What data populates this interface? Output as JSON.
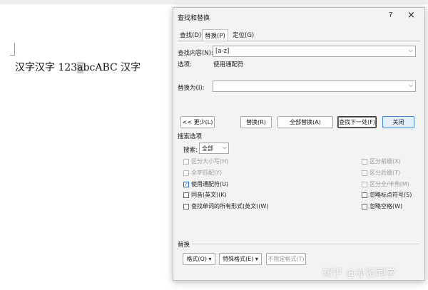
{
  "document": {
    "text_before": "汉字汉字 123",
    "text_selected": "a",
    "text_after": "bcABC 汉字"
  },
  "dialog": {
    "title": "查找和替换",
    "help": "?",
    "close": "×",
    "tabs": [
      {
        "label": "查找(D)"
      },
      {
        "label": "替换(P)"
      },
      {
        "label": "定位(G)"
      }
    ],
    "find": {
      "label": "查找内容(N):",
      "value": "[a-z]"
    },
    "options": {
      "label": "选项:",
      "value": "使用通配符"
    },
    "replace": {
      "label": "替换为(I):",
      "value": ""
    },
    "buttons": {
      "less": "<< 更少(L)",
      "replace": "替换(R)",
      "replace_all": "全部替换(A)",
      "find_next": "查找下一处(F)",
      "close": "关闭"
    },
    "search_options": {
      "title": "搜索选项",
      "search_label": "搜索:",
      "search_value": "全部",
      "left": [
        {
          "label": "区分大小写(H)",
          "disabled": true,
          "checked": false
        },
        {
          "label": "全字匹配(Y)",
          "disabled": true,
          "checked": false
        },
        {
          "label": "使用通配符(U)",
          "disabled": false,
          "checked": true
        },
        {
          "label": "同音(英文)(K)",
          "disabled": false,
          "checked": false
        },
        {
          "label": "查找单词的所有形式(英文)(W)",
          "disabled": false,
          "checked": false
        }
      ],
      "right": [
        {
          "label": "区分前缀(X)",
          "disabled": true,
          "checked": false
        },
        {
          "label": "区分后缀(T)",
          "disabled": true,
          "checked": false
        },
        {
          "label": "区分全/半角(M)",
          "disabled": true,
          "checked": false
        },
        {
          "label": "忽略标点符号(S)",
          "disabled": false,
          "checked": false
        },
        {
          "label": "忽略空格(W)",
          "disabled": false,
          "checked": false
        }
      ]
    },
    "replace_section": {
      "title": "替换",
      "format": "格式(O) ▾",
      "special": "特殊格式(E) ▾",
      "no_format": "不限定格式(T)"
    }
  },
  "watermark": "知乎 @亦贤同学",
  "colors": {
    "accent": "#3c8ad8",
    "check": "#1d6fc9"
  }
}
